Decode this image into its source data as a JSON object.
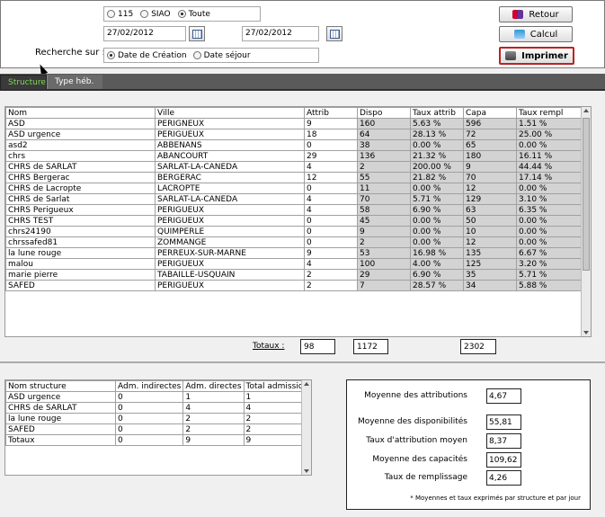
{
  "filters": {
    "type_options": [
      {
        "label": "115",
        "selected": false
      },
      {
        "label": "SIAO",
        "selected": false
      },
      {
        "label": "Toute",
        "selected": true
      }
    ],
    "date_start": "27/02/2012",
    "date_end": "27/02/2012",
    "search_label": "Recherche sur :",
    "search_options": [
      {
        "label": "Date de Création",
        "selected": true
      },
      {
        "label": "Date séjour",
        "selected": false
      }
    ]
  },
  "buttons": {
    "retour": "Retour",
    "calcul": "Calcul",
    "imprimer": "Imprimer"
  },
  "tabs": [
    "Structure",
    "Type héb."
  ],
  "grid": {
    "columns": [
      "Nom",
      "Ville",
      "Attrib",
      "Dispo",
      "Taux attrib",
      "Capa",
      "Taux rempl"
    ],
    "rows": [
      [
        "ASD",
        "PERIGNEUX",
        "9",
        "160",
        "5.63 %",
        "596",
        "1.51 %"
      ],
      [
        "ASD urgence",
        "PERIGUEUX",
        "18",
        "64",
        "28.13 %",
        "72",
        "25.00 %"
      ],
      [
        "asd2",
        "ABBENANS",
        "0",
        "38",
        "0.00 %",
        "65",
        "0.00 %"
      ],
      [
        "chrs",
        "ABANCOURT",
        "29",
        "136",
        "21.32 %",
        "180",
        "16.11 %"
      ],
      [
        "CHRS  de SARLAT",
        "SARLAT-LA-CANEDA",
        "4",
        "2",
        "200.00 %",
        "9",
        "44.44 %"
      ],
      [
        "CHRS Bergerac",
        "BERGERAC",
        "12",
        "55",
        "21.82 %",
        "70",
        "17.14 %"
      ],
      [
        "CHRS de Lacropte",
        "LACROPTE",
        "0",
        "11",
        "0.00 %",
        "12",
        "0.00 %"
      ],
      [
        "CHRS de Sarlat",
        "SARLAT-LA-CANEDA",
        "4",
        "70",
        "5.71 %",
        "129",
        "3.10 %"
      ],
      [
        "CHRS Perigueux",
        "PERIGUEUX",
        "4",
        "58",
        "6.90 %",
        "63",
        "6.35 %"
      ],
      [
        "CHRS TEST",
        "PERIGUEUX",
        "0",
        "45",
        "0.00 %",
        "50",
        "0.00 %"
      ],
      [
        "chrs24190",
        "QUIMPERLE",
        "0",
        "9",
        "0.00 %",
        "10",
        "0.00 %"
      ],
      [
        "chrssafed81",
        "ZOMMANGE",
        "0",
        "2",
        "0.00 %",
        "12",
        "0.00 %"
      ],
      [
        "la lune rouge",
        "PERREUX-SUR-MARNE",
        "9",
        "53",
        "16.98 %",
        "135",
        "6.67 %"
      ],
      [
        "malou",
        "PERIGUEUX",
        "4",
        "100",
        "4.00 %",
        "125",
        "3.20 %"
      ],
      [
        "marie pierre",
        "TABAILLE-USQUAIN",
        "2",
        "29",
        "6.90 %",
        "35",
        "5.71 %"
      ],
      [
        "SAFED",
        "PERIGUEUX",
        "2",
        "7",
        "28.57 %",
        "34",
        "5.88 %"
      ]
    ]
  },
  "totaux": {
    "label": "Totaux :",
    "attrib": "98",
    "dispo": "1172",
    "capa": "2302"
  },
  "grid2": {
    "columns": [
      "Nom structure",
      "Adm. indirectes",
      "Adm. directes",
      "Total admission"
    ],
    "rows": [
      [
        "ASD urgence",
        "0",
        "1",
        "1"
      ],
      [
        "CHRS  de SARLAT",
        "0",
        "4",
        "4"
      ],
      [
        "la lune rouge",
        "0",
        "2",
        "2"
      ],
      [
        "SAFED",
        "0",
        "2",
        "2"
      ],
      [
        "Totaux",
        "0",
        "9",
        "9"
      ]
    ]
  },
  "stats": [
    {
      "label": "Moyenne des attributions",
      "value": "4,67"
    },
    {
      "label": "Moyenne des disponibilités",
      "value": "55,81"
    },
    {
      "label": "Taux d'attribution moyen",
      "value": "8,37"
    },
    {
      "label": "Moyenne des capacités",
      "value": "109,62"
    },
    {
      "label": "Taux de remplissage",
      "value": "4,26"
    }
  ],
  "footnote": "* Moyennes et taux exprimés par structure et par jour"
}
